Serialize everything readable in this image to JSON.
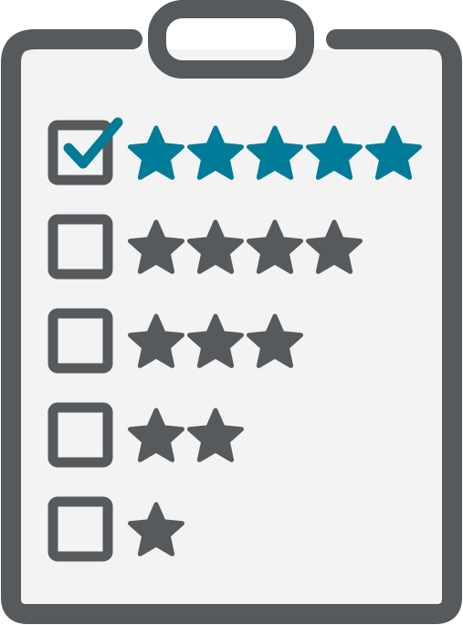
{
  "colors": {
    "outline": "#575a5d",
    "accent": "#007c99",
    "paper": "#f3f3f4",
    "background": "#ffffff"
  },
  "icon": "clipboard-rating-icon",
  "ratings": [
    {
      "stars": 5,
      "checked": true
    },
    {
      "stars": 4,
      "checked": false
    },
    {
      "stars": 3,
      "checked": false
    },
    {
      "stars": 2,
      "checked": false
    },
    {
      "stars": 1,
      "checked": false
    }
  ]
}
